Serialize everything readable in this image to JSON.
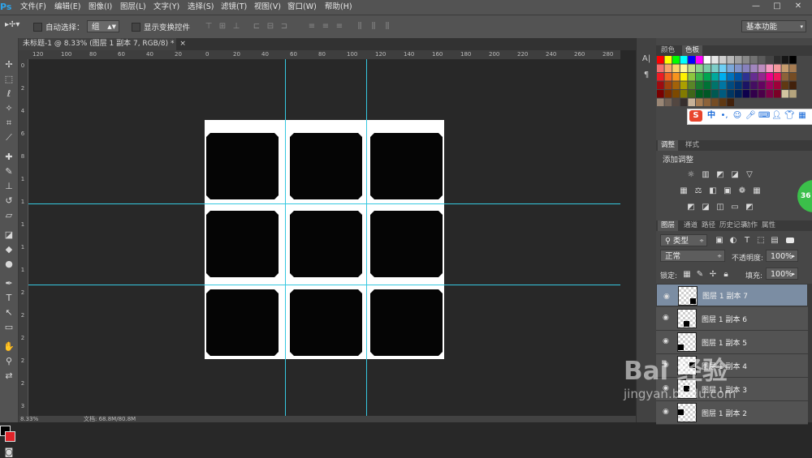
{
  "app": {
    "logo": "Ps"
  },
  "menu": [
    "文件(F)",
    "编辑(E)",
    "图像(I)",
    "图层(L)",
    "文字(Y)",
    "选择(S)",
    "滤镜(T)",
    "视图(V)",
    "窗口(W)",
    "帮助(H)"
  ],
  "window_controls": {
    "min": "—",
    "max": "□",
    "close": "✕"
  },
  "options": {
    "auto_select_label": "自动选择：",
    "auto_select_value": "组",
    "show_transform_label": "显示变换控件",
    "workspace": "基本功能"
  },
  "document": {
    "tab_title": "未标题-1 @ 8.33% (图层 1 副本 7, RGB/8) *",
    "tab_close": "×",
    "ruler_h_ticks": [
      "120",
      "100",
      "80",
      "60",
      "40",
      "20",
      "0",
      "20",
      "40",
      "60",
      "80",
      "100",
      "120",
      "140",
      "160",
      "180",
      "200",
      "220",
      "240",
      "260",
      "280"
    ],
    "ruler_v_ticks": [
      "0",
      "2",
      "4",
      "6",
      "8",
      "1",
      "1",
      "1",
      "1",
      "1",
      "2",
      "2",
      "2",
      "2",
      "2",
      "3"
    ]
  },
  "status": {
    "zoom": "8.33%",
    "doc_info": "文档: 68.8M/80.8M"
  },
  "panels": {
    "color_tabs": [
      "颜色",
      "色板"
    ],
    "adjust_tabs": [
      "调整",
      "样式"
    ],
    "adjust_title": "添加调整",
    "layers_tabs": [
      "图层",
      "通道",
      "路径",
      "历史记录",
      "动作",
      "属性"
    ],
    "filter_kind": "类型",
    "blend_mode": "正常",
    "opacity_label": "不透明度:",
    "opacity_value": "100%",
    "lock_label": "锁定:",
    "fill_label": "填充:",
    "fill_value": "100%",
    "layers": [
      {
        "name": "图层 1 副本 7"
      },
      {
        "name": "图层 1 副本 6"
      },
      {
        "name": "图层 1 副本 5"
      },
      {
        "name": "图层 1 副本 4"
      },
      {
        "name": "图层 1 副本 3"
      },
      {
        "name": "图层 1 副本 2"
      }
    ]
  },
  "ime": {
    "s": "S",
    "lang": "中"
  },
  "badge": "36",
  "watermark": {
    "main": "Bai 经验",
    "sub": "jingyan.baidu.com"
  }
}
